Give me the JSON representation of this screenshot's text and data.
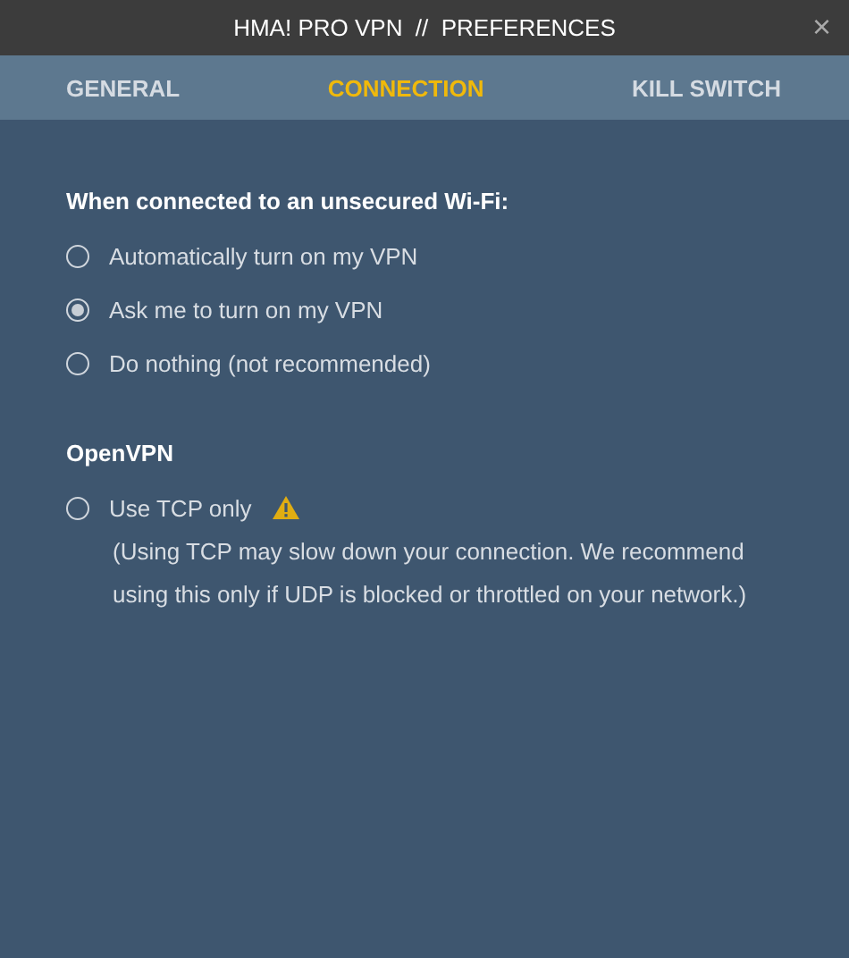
{
  "window": {
    "title": "HMA! PRO VPN  //  PREFERENCES",
    "close": "×"
  },
  "tabs": [
    {
      "label": "GENERAL",
      "selected": false
    },
    {
      "label": "CONNECTION",
      "selected": true
    },
    {
      "label": "KILL SWITCH",
      "selected": false
    }
  ],
  "wifi_section": {
    "heading": "When connected to an unsecured Wi-Fi:",
    "options": [
      {
        "label": "Automatically turn on my VPN",
        "selected": false
      },
      {
        "label": "Ask me to turn on my VPN",
        "selected": true
      },
      {
        "label": "Do nothing (not recommended)",
        "selected": false
      }
    ]
  },
  "openvpn_section": {
    "heading": "OpenVPN",
    "option": {
      "label": "Use TCP only",
      "checked": false,
      "warning": true
    },
    "note": "(Using TCP may slow down your connection. We recommend using this only if UDP is blocked or throttled on your network.)"
  }
}
